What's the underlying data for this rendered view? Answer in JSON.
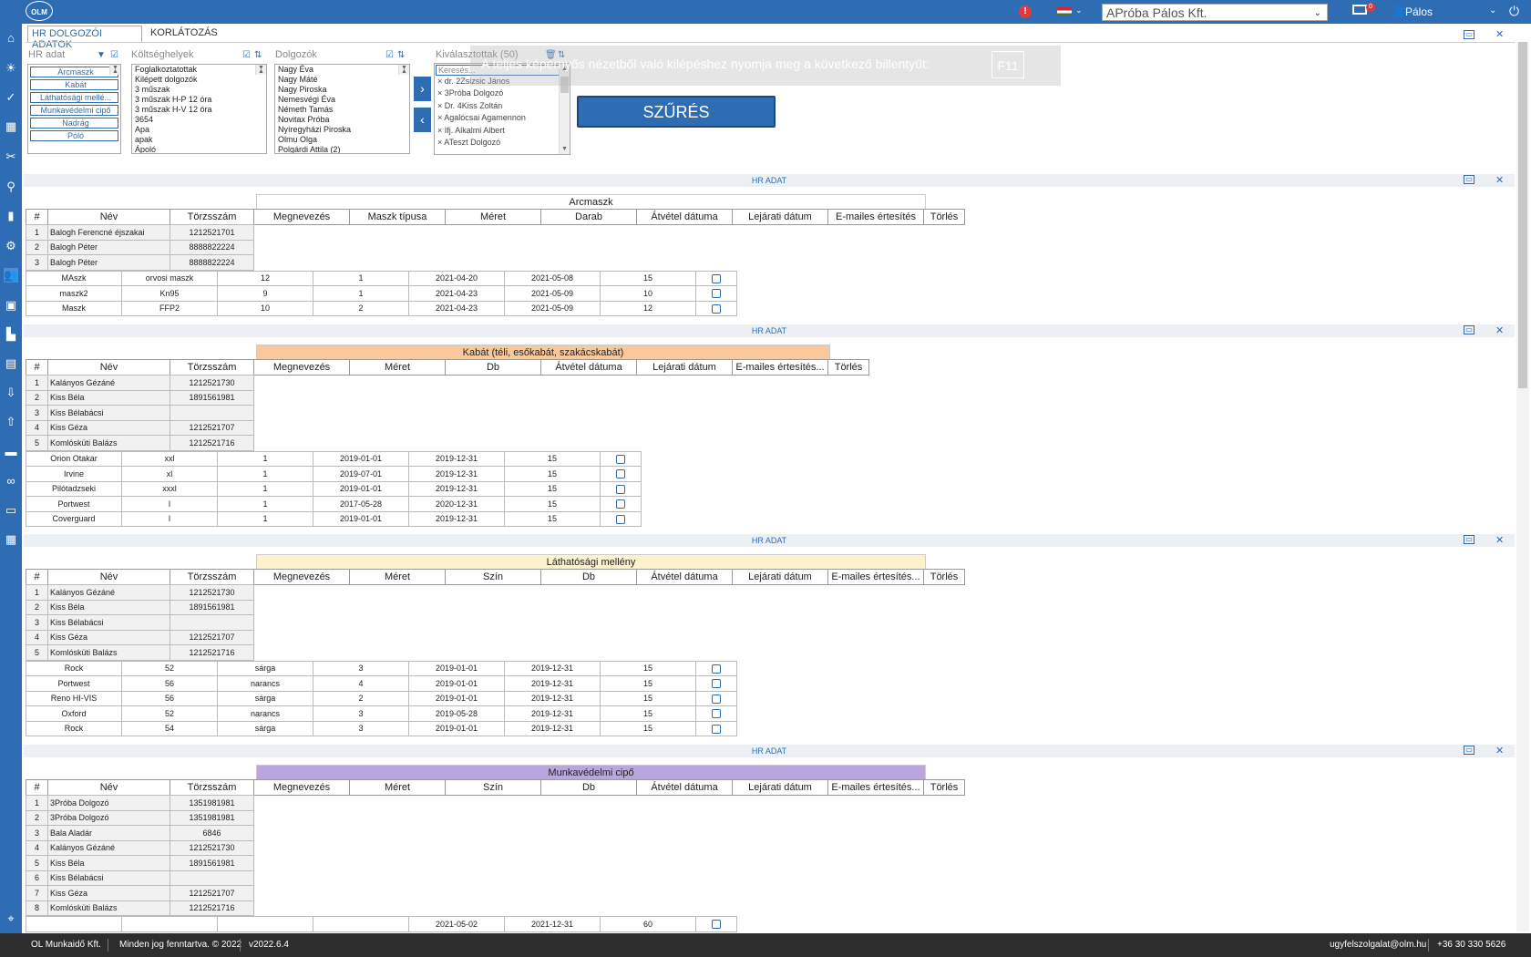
{
  "topbar": {
    "logo": "OLM",
    "company": "APróba Pálos Kft.",
    "mail_badge": "0",
    "user": "Pálos"
  },
  "tabs": [
    "HR DOLGOZÓI ADATOK",
    "KORLÁTOZÁS"
  ],
  "filters": {
    "hr_label": "HR adat",
    "hr_items": [
      "Arcmaszk",
      "Kabát",
      "Láthatósági mellé...",
      "Munkavédelmi cipő",
      "Nadrág",
      "Póló"
    ],
    "kh_label": "Költséghelyek",
    "kh_items": [
      "Foglalkoztatottak",
      "Kilépett dolgozók",
      "3 műszak",
      "3 műszak H-P 12 óra",
      "3 műszak H-V 12 óra",
      "3654",
      "Apa",
      "apak",
      "Ápoló"
    ],
    "dolg_label": "Dolgozók",
    "dolg_items": [
      "Nagy Éva",
      "Nagy Máté",
      "Nagy Piroska",
      "Nemesvégi Éva",
      "Németh Tamás",
      "Novitax Próba",
      "Nyíregyházi Piroska",
      "Olmu Olga",
      "Polgárdi Attila (2)"
    ],
    "kiv_label": "Kiválasztottak (50)",
    "kiv_search": "Keresés...",
    "kiv_items": [
      "dr. 2Zsizsic János",
      "3Próba Dolgozó",
      "Dr. 4Kiss Zoltán",
      "Agalócsai Agamennon",
      "Ifj. Alkalmi Albert",
      "ATeszt Dolgozó"
    ],
    "szures": "SZŰRÉS",
    "fs_text": "A teljes képernyős nézetből való kilépéshez nyomja meg a következő billentyűt:",
    "fs_key": "F11"
  },
  "section_label": "HR ADAT",
  "sections": [
    {
      "title": "Arcmaszk",
      "title_color": "#ffffff",
      "headers": [
        "#",
        "Név",
        "Törzsszám",
        "Megnevezés",
        "Maszk típusa",
        "Méret",
        "Darab",
        "Átvétel dátuma",
        "Lejárati dátum",
        "E-mailes értesítés",
        "Törlés"
      ],
      "employees": [
        [
          "1",
          "Balogh Ferencné éjszakai",
          "1212521701"
        ],
        [
          "2",
          "Balogh Péter",
          "8888822224"
        ],
        [
          "3",
          "Balogh Péter",
          "8888822224"
        ]
      ],
      "items": [
        [
          "MAszk",
          "orvosi maszk",
          "12",
          "1",
          "2021-04-20",
          "2021-05-08",
          "15"
        ],
        [
          "maszk2",
          "Kn95",
          "9",
          "1",
          "2021-04-23",
          "2021-05-09",
          "10"
        ],
        [
          "Maszk",
          "FFP2",
          "10",
          "2",
          "2021-04-23",
          "2021-05-09",
          "12"
        ]
      ]
    },
    {
      "title": "Kabát (téli, esőkabát, szakácskabát)",
      "title_color": "#f9c99b",
      "headers": [
        "#",
        "Név",
        "Törzsszám",
        "Megnevezés",
        "Méret",
        "Db",
        "Átvétel dátuma",
        "Lejárati dátum",
        "E-mailes értesítés...",
        "Törlés"
      ],
      "employees": [
        [
          "1",
          "Kalányos Gézáné",
          "1212521730"
        ],
        [
          "2",
          "Kiss Béla",
          "1891561981"
        ],
        [
          "3",
          "Kiss Bélabácsi",
          ""
        ],
        [
          "4",
          "Kiss Géza",
          "1212521707"
        ],
        [
          "5",
          "Komlósküti Balázs",
          "1212521716"
        ]
      ],
      "items": [
        [
          "Orion Otakar",
          "xxl",
          "1",
          "2019-01-01",
          "2019-12-31",
          "15"
        ],
        [
          "Irvine",
          "xl",
          "1",
          "2019-07-01",
          "2019-12-31",
          "15"
        ],
        [
          "Pilótadzseki",
          "xxxl",
          "1",
          "2019-01-01",
          "2019-12-31",
          "15"
        ],
        [
          "Portwest",
          "l",
          "1",
          "2017-05-28",
          "2020-12-31",
          "15"
        ],
        [
          "Coverguard",
          "l",
          "1",
          "2019-01-01",
          "2019-12-31",
          "15"
        ]
      ]
    },
    {
      "title": "Láthatósági mellény",
      "title_color": "#fdf2cc",
      "headers": [
        "#",
        "Név",
        "Törzsszám",
        "Megnevezés",
        "Méret",
        "Szín",
        "Db",
        "Átvétel dátuma",
        "Lejárati dátum",
        "E-mailes értesítés...",
        "Törlés"
      ],
      "employees": [
        [
          "1",
          "Kalányos Gézáné",
          "1212521730"
        ],
        [
          "2",
          "Kiss Béla",
          "1891561981"
        ],
        [
          "3",
          "Kiss Bélabácsi",
          ""
        ],
        [
          "4",
          "Kiss Géza",
          "1212521707"
        ],
        [
          "5",
          "Komlósküti Balázs",
          "1212521716"
        ]
      ],
      "items": [
        [
          "Rock",
          "52",
          "sárga",
          "3",
          "2019-01-01",
          "2019-12-31",
          "15"
        ],
        [
          "Portwest",
          "56",
          "narancs",
          "4",
          "2019-01-01",
          "2019-12-31",
          "15"
        ],
        [
          "Reno HI-VIS",
          "56",
          "sárga",
          "2",
          "2019-01-01",
          "2019-12-31",
          "15"
        ],
        [
          "Oxford",
          "52",
          "narancs",
          "3",
          "2019-05-28",
          "2019-12-31",
          "15"
        ],
        [
          "Rock",
          "54",
          "sárga",
          "3",
          "2019-01-01",
          "2019-12-31",
          "15"
        ]
      ]
    },
    {
      "title": "Munkavédelmi cipő",
      "title_color": "#b9a6dc",
      "headers": [
        "#",
        "Név",
        "Törzsszám",
        "Megnevezés",
        "Méret",
        "Szín",
        "Db",
        "Átvétel dátuma",
        "Lejárati dátum",
        "E-mailes értesítés...",
        "Törlés"
      ],
      "employees": [
        [
          "1",
          "3Próba Dolgozó",
          "1351981981"
        ],
        [
          "2",
          "3Próba Dolgozó",
          "1351981981"
        ],
        [
          "3",
          "Bala Aladár",
          "6846"
        ],
        [
          "4",
          "Kalányos Gézáné",
          "1212521730"
        ],
        [
          "5",
          "Kiss Béla",
          "1891561981"
        ],
        [
          "6",
          "Kiss Bélabácsi",
          ""
        ],
        [
          "7",
          "Kiss Géza",
          "1212521707"
        ],
        [
          "8",
          "Komlósküti Balázs",
          "1212521716"
        ]
      ],
      "items": [
        [
          "",
          "",
          "",
          "",
          "2021-05-02",
          "2021-12-31",
          "60"
        ]
      ]
    }
  ],
  "footer": {
    "company": "OL Munkaidő Kft.",
    "rights": "Minden jog fenntartva. © 2022",
    "version": "v2022.6.4",
    "email": "ugyfelszolgalat@olm.hu",
    "phone": "+36 30 330 5626"
  }
}
